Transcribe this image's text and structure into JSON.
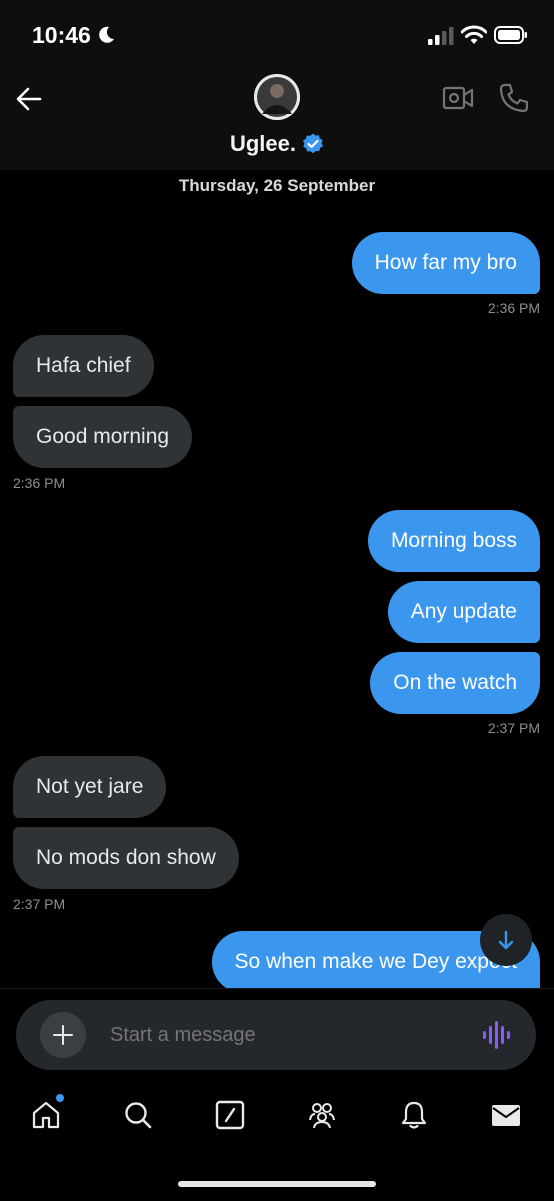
{
  "status_bar": {
    "time": "10:46"
  },
  "header": {
    "contact_name": "Uglee."
  },
  "date_separator": "Thursday, 26 September",
  "messages": [
    {
      "direction": "out",
      "text": "How far my bro"
    },
    {
      "timestamp": "2:36 PM"
    },
    {
      "direction": "in",
      "text": "Hafa chief"
    },
    {
      "direction": "in",
      "text": "Good morning"
    },
    {
      "timestamp": "2:36 PM"
    },
    {
      "direction": "out",
      "text": "Morning boss"
    },
    {
      "direction": "out",
      "text": "Any update"
    },
    {
      "direction": "out",
      "text": "On the watch"
    },
    {
      "timestamp": "2:37 PM"
    },
    {
      "direction": "in",
      "text": "Not yet jare"
    },
    {
      "direction": "in",
      "text": "No mods don show"
    },
    {
      "timestamp": "2:37 PM"
    },
    {
      "direction": "out",
      "text": "So when make we Dey expect"
    }
  ],
  "composer": {
    "placeholder": "Start a message"
  },
  "nav": {
    "items": [
      {
        "icon": "home-icon",
        "has_badge": true
      },
      {
        "icon": "search-icon"
      },
      {
        "icon": "grok-icon"
      },
      {
        "icon": "communities-icon"
      },
      {
        "icon": "notifications-icon"
      },
      {
        "icon": "messages-icon",
        "active": true
      }
    ]
  },
  "colors": {
    "accent": "#3b97ed",
    "incoming_bubble": "#2f3336",
    "background": "#000000",
    "voice_icon": "#8a5cf6"
  }
}
